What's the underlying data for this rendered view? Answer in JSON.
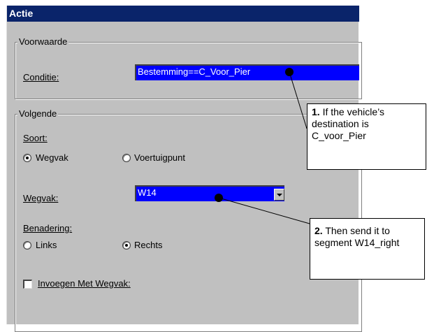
{
  "dialog": {
    "title": "Actie",
    "voorwaarde": {
      "legend": "Voorwaarde",
      "conditie_label": "Conditie:",
      "conditie_value": "Bestemming==C_Voor_Pier"
    },
    "volgende": {
      "legend": "Volgende",
      "soort_label": "Soort:",
      "soort_options": [
        {
          "label": "Wegvak",
          "selected": true
        },
        {
          "label": "Voertuigpunt",
          "selected": false
        }
      ],
      "wegvak_label": "Wegvak:",
      "wegvak_value": "W14",
      "benadering_label": "Benadering:",
      "benadering_options": [
        {
          "label": "Links",
          "selected": false
        },
        {
          "label": "Rechts",
          "selected": true
        }
      ],
      "invoegen_label": "Invoegen Met Wegvak:",
      "invoegen_checked": false
    }
  },
  "callouts": [
    {
      "number": "1.",
      "text": "If the vehicle’s destination is C_voor_Pier"
    },
    {
      "number": "2.",
      "text": "Then send it to segment W14_right"
    }
  ],
  "colors": {
    "titlebar": "#0a246a",
    "field_highlight": "#0000ff",
    "dialog_face": "#c0c0c0"
  }
}
